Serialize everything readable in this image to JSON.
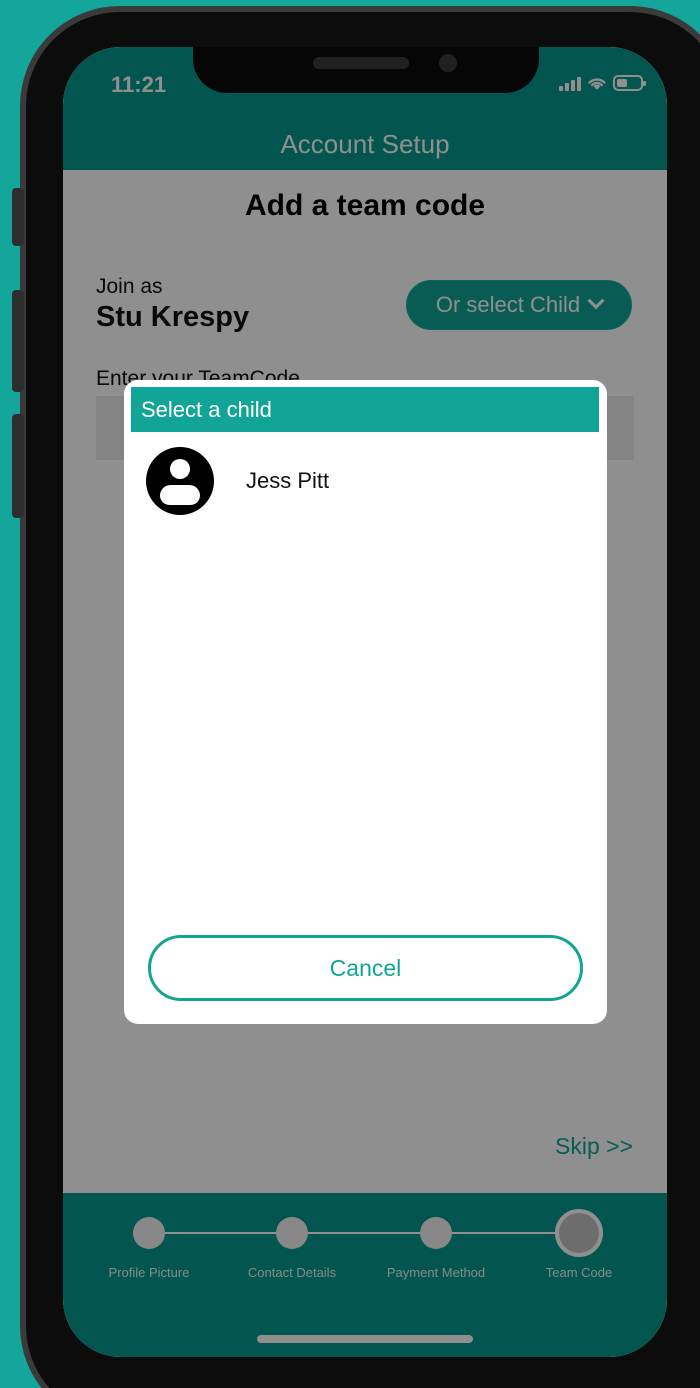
{
  "status_bar": {
    "time": "11:21"
  },
  "header": {
    "title": "Account Setup"
  },
  "page": {
    "title": "Add a team code",
    "join_as_label": "Join as",
    "join_as_name": "Stu Krespy",
    "select_child_label": "Or select Child",
    "teamcode_label": "Enter your TeamCode",
    "skip_label": "Skip >>"
  },
  "steps": [
    {
      "label": "Profile Picture",
      "state": "complete"
    },
    {
      "label": "Contact Details",
      "state": "complete"
    },
    {
      "label": "Payment Method",
      "state": "complete"
    },
    {
      "label": "Team Code",
      "state": "current"
    }
  ],
  "modal": {
    "title": "Select a child",
    "children": [
      {
        "name": "Jess Pitt"
      }
    ],
    "cancel_label": "Cancel"
  },
  "colors": {
    "accent": "#11a497",
    "header_bg": "#079a8d",
    "page_bg": "#14a59b"
  }
}
